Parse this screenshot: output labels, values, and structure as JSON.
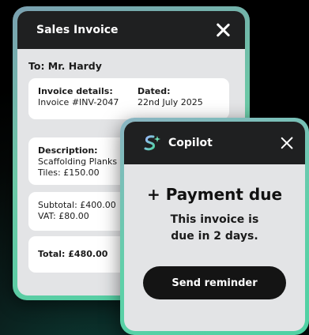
{
  "invoice": {
    "title": "Sales Invoice",
    "to": "To: Mr. Hardy",
    "details": {
      "label": "Invoice details:",
      "number": "Invoice #INV-2047",
      "dated_label": "Dated:",
      "date": "22nd July 2025"
    },
    "description": {
      "label": "Description:",
      "line1": "Scaffolding Planks",
      "line2": "Tiles: £150.00"
    },
    "totals": {
      "subtotal": "Subtotal: £400.00",
      "vat": "VAT: £80.00"
    },
    "total": "Total: £480.00"
  },
  "copilot": {
    "name": "Copilot",
    "title": "+ Payment due",
    "message_line1": "This invoice is",
    "message_line2_prefix": "due in ",
    "message_line2_value": "2 days.",
    "button_label": "Send reminder"
  },
  "colors": {
    "header_bg": "#1f2021",
    "panel_bg": "#e3e4e6",
    "accent_green": "#4fd1a3",
    "accent_blue": "#7aa0b0"
  }
}
